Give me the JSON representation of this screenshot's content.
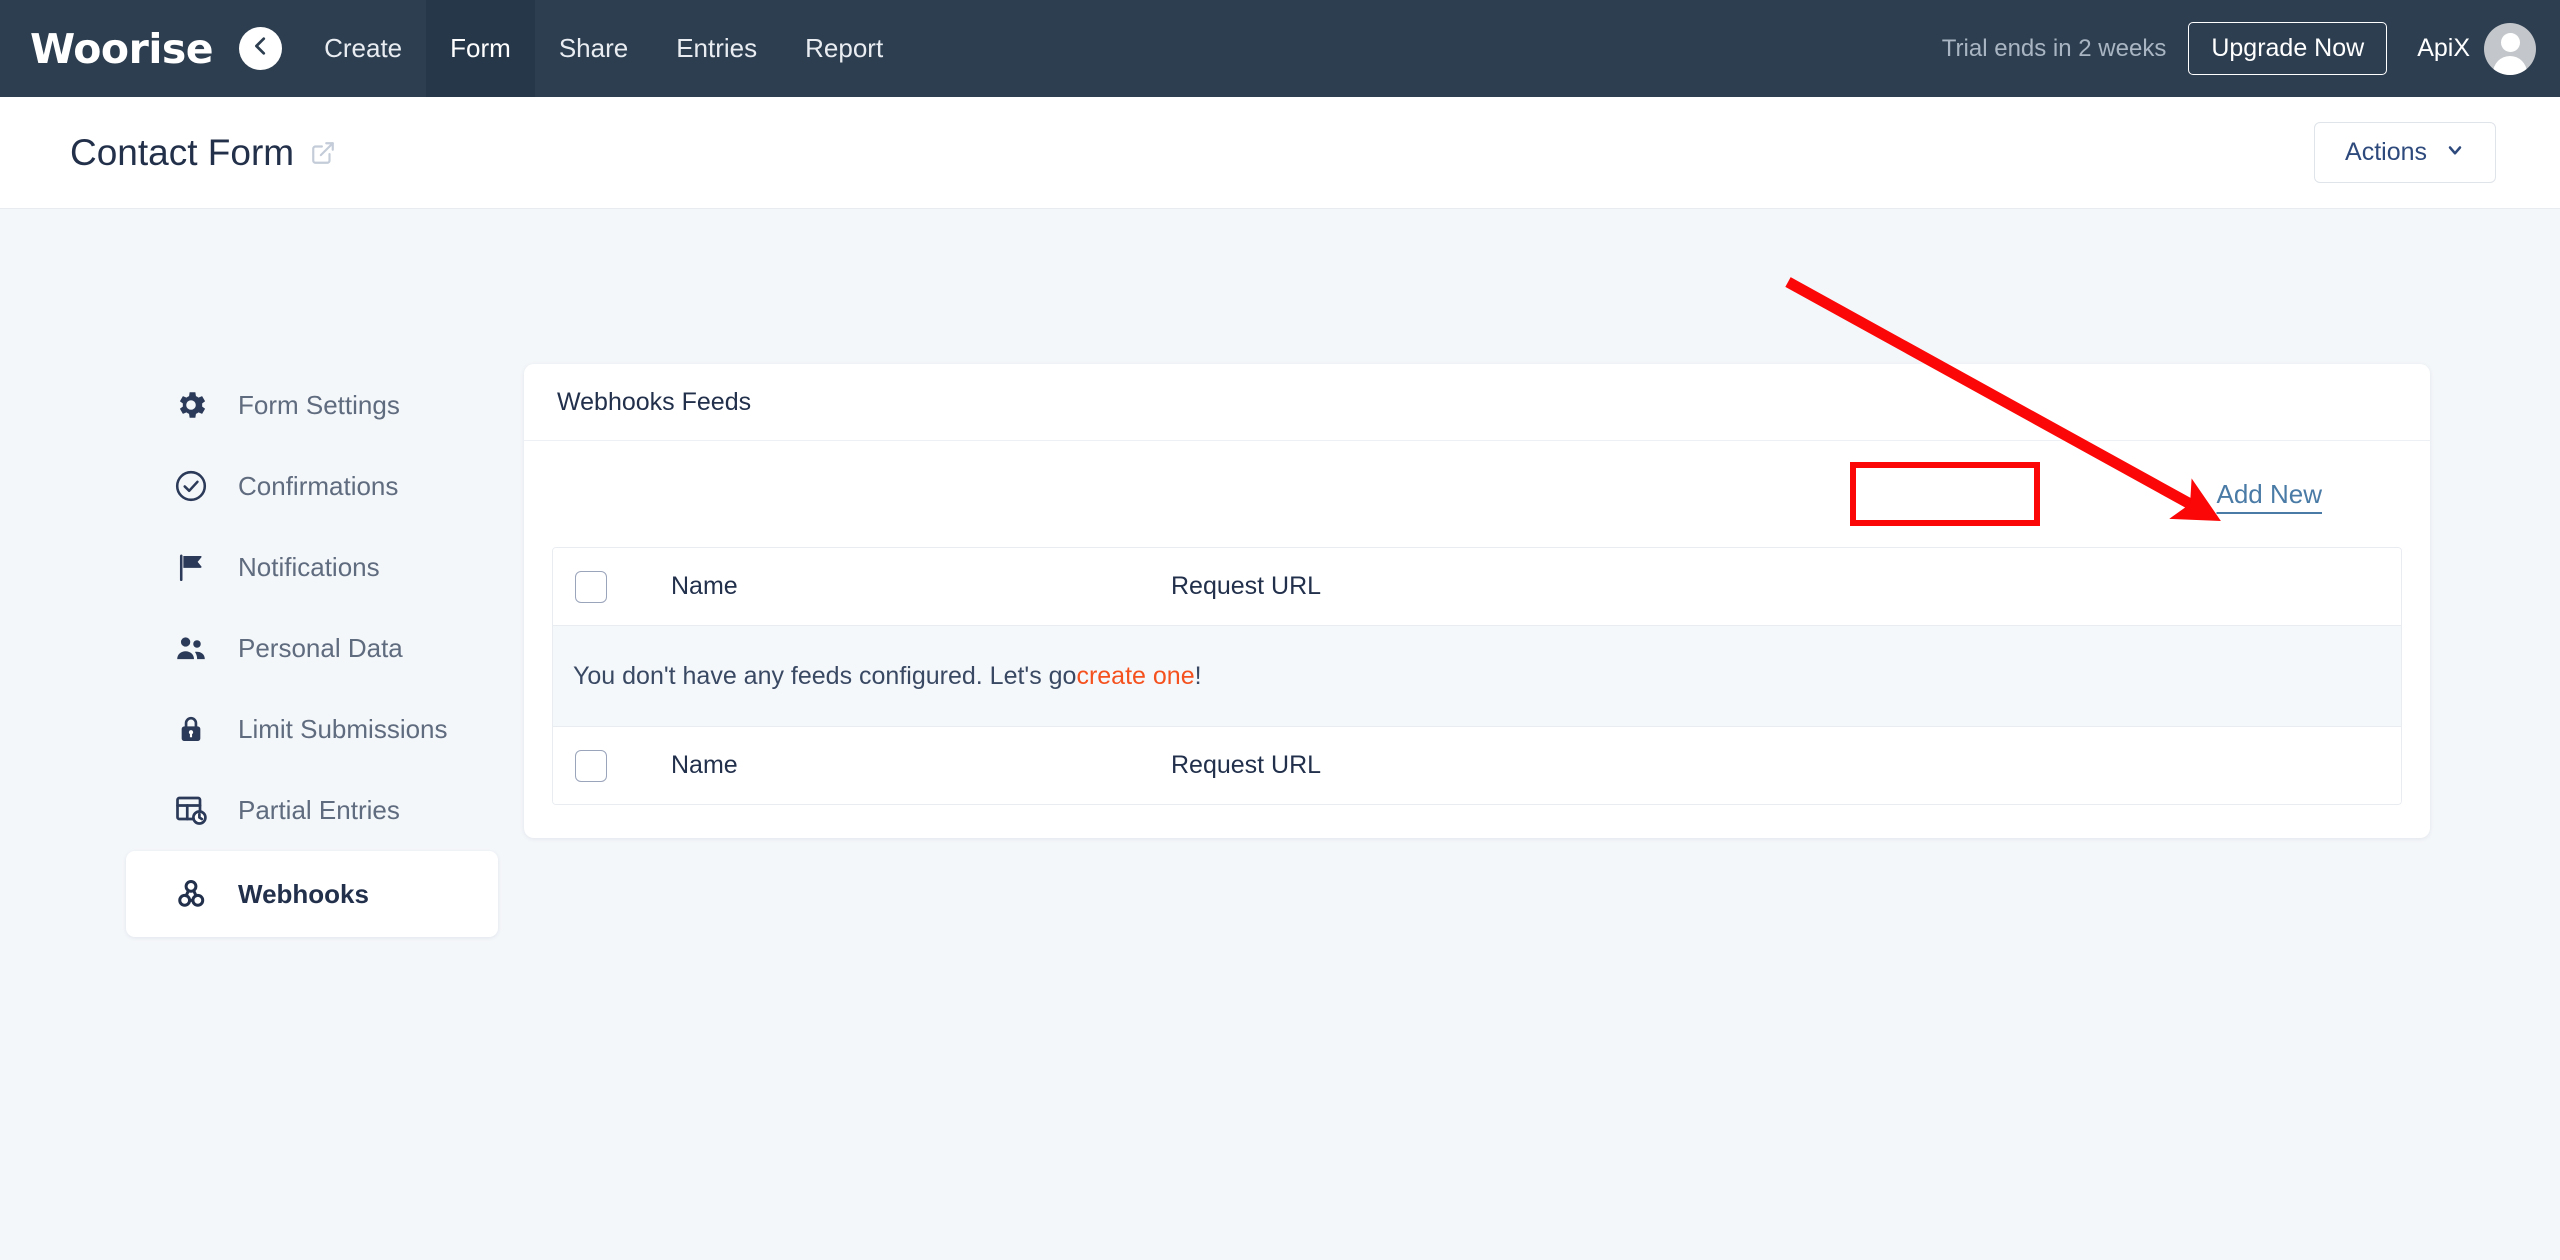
{
  "navbar": {
    "brand": "Woorise",
    "back_icon": "chevron-left-icon",
    "tabs": [
      {
        "label": "Create",
        "active": false
      },
      {
        "label": "Form",
        "active": true
      },
      {
        "label": "Share",
        "active": false
      },
      {
        "label": "Entries",
        "active": false
      },
      {
        "label": "Report",
        "active": false
      }
    ],
    "trial_text": "Trial ends in 2 weeks",
    "upgrade_label": "Upgrade Now",
    "user_name": "ApiX",
    "avatar_icon": "user-avatar-icon"
  },
  "subheader": {
    "title": "Contact Form",
    "external_link_icon": "external-link-icon",
    "actions_label": "Actions",
    "actions_caret_icon": "chevron-down-icon"
  },
  "sidebar": {
    "items": [
      {
        "label": "Form Settings",
        "icon": "gear-icon",
        "active": false
      },
      {
        "label": "Confirmations",
        "icon": "check-circle-icon",
        "active": false
      },
      {
        "label": "Notifications",
        "icon": "flag-icon",
        "active": false
      },
      {
        "label": "Personal Data",
        "icon": "people-icon",
        "active": false
      },
      {
        "label": "Limit Submissions",
        "icon": "lock-icon",
        "active": false
      },
      {
        "label": "Partial Entries",
        "icon": "table-clock-icon",
        "active": false
      },
      {
        "label": "Webhooks",
        "icon": "webhook-icon",
        "active": true
      }
    ]
  },
  "main": {
    "card_title": "Webhooks Feeds",
    "add_new_label": "Add New",
    "table": {
      "columns": [
        "Name",
        "Request URL"
      ],
      "header": {
        "name": "Name",
        "url": "Request URL"
      },
      "footer": {
        "name": "Name",
        "url": "Request URL"
      },
      "rows": [],
      "empty_message_prefix": "You don't have any feeds configured. Let's go ",
      "empty_message_link": "create one",
      "empty_message_suffix": "!"
    }
  },
  "annotations": {
    "arrow_color": "#fb0707",
    "highlight_box_color": "#fb0707",
    "arrow_from": "1788,282",
    "arrow_to": "2205,512",
    "highlight_target": "Add New"
  },
  "colors": {
    "navbar_bg": "#2d3e50",
    "navbar_active_bg": "#26374a",
    "page_bg": "#f4f7fa",
    "card_bg": "#ffffff",
    "link_blue": "#4a7ba6",
    "link_orange": "#f4511e",
    "text_dark": "#22304c",
    "text_muted": "#5f6b7e"
  }
}
